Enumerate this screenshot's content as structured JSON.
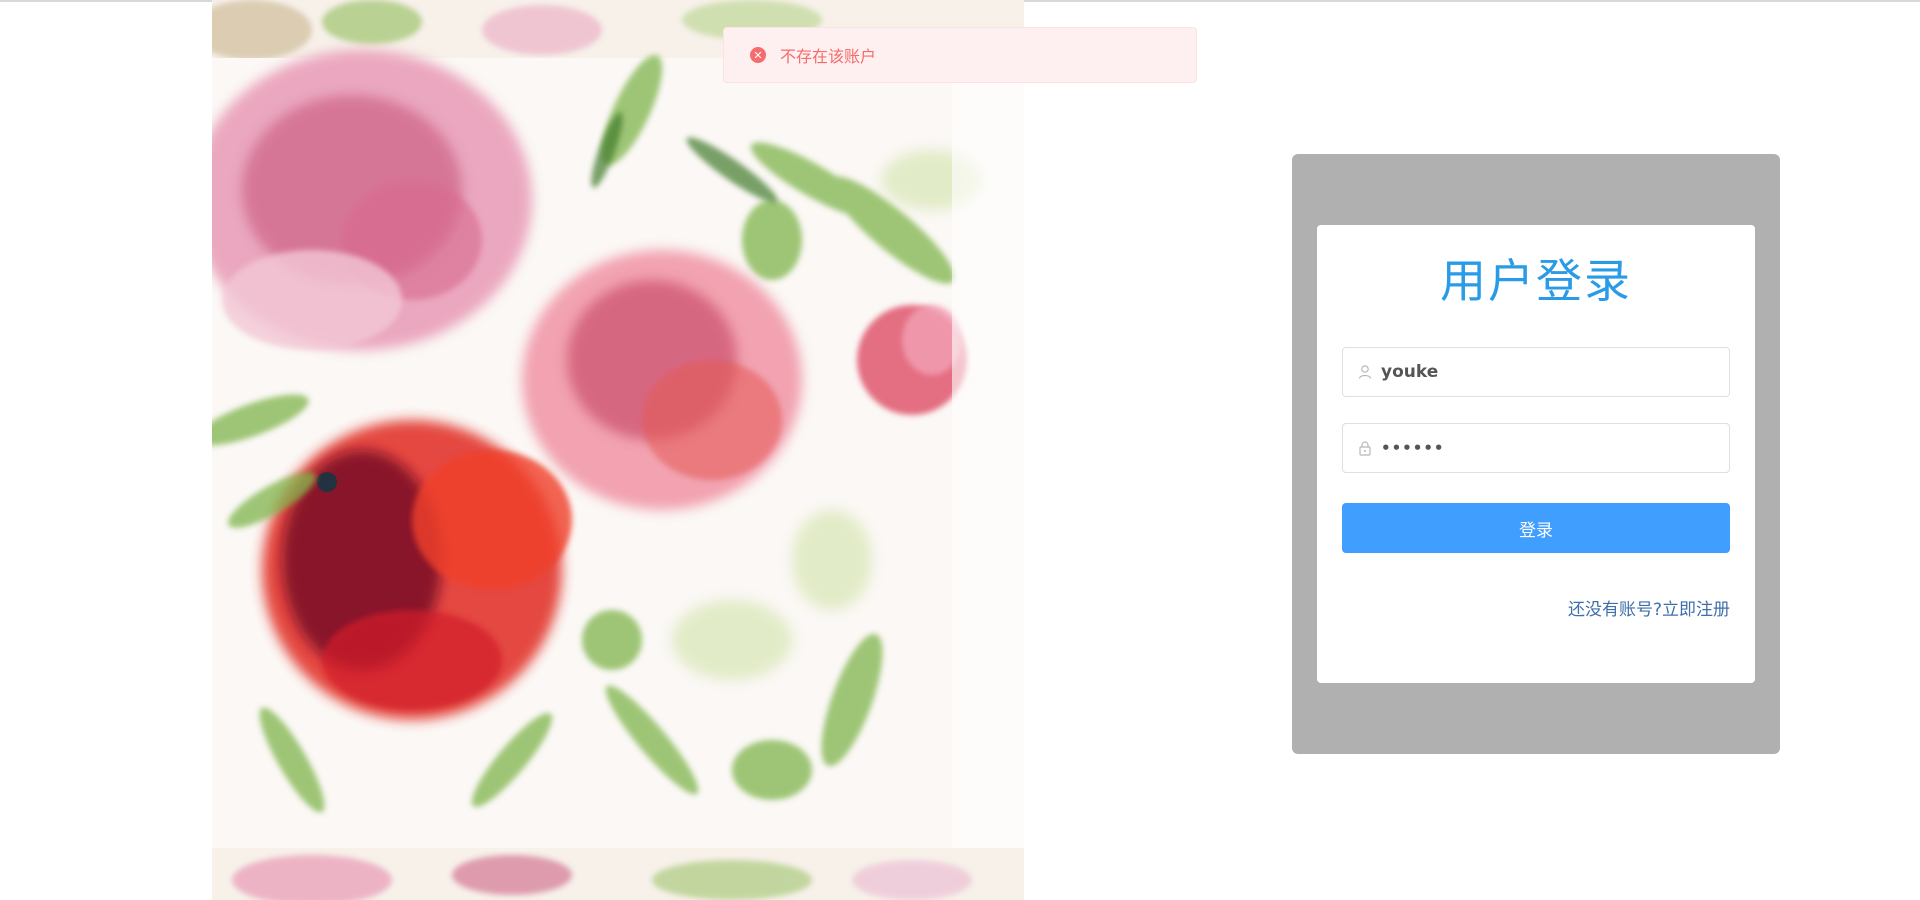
{
  "toast": {
    "icon": "error-icon",
    "message": "不存在该账户"
  },
  "login": {
    "title": "用户登录",
    "username_value": "youke",
    "password_value": "••••••",
    "user_icon": "user-icon",
    "lock_icon": "lock-icon",
    "submit_label": "登录",
    "register_prompt": "还没有账号?",
    "register_link": "立即注册"
  },
  "colors": {
    "accent": "#409eff",
    "title": "#2a9be7",
    "error": "#f56c6c",
    "panel": "#b0b0b0"
  }
}
